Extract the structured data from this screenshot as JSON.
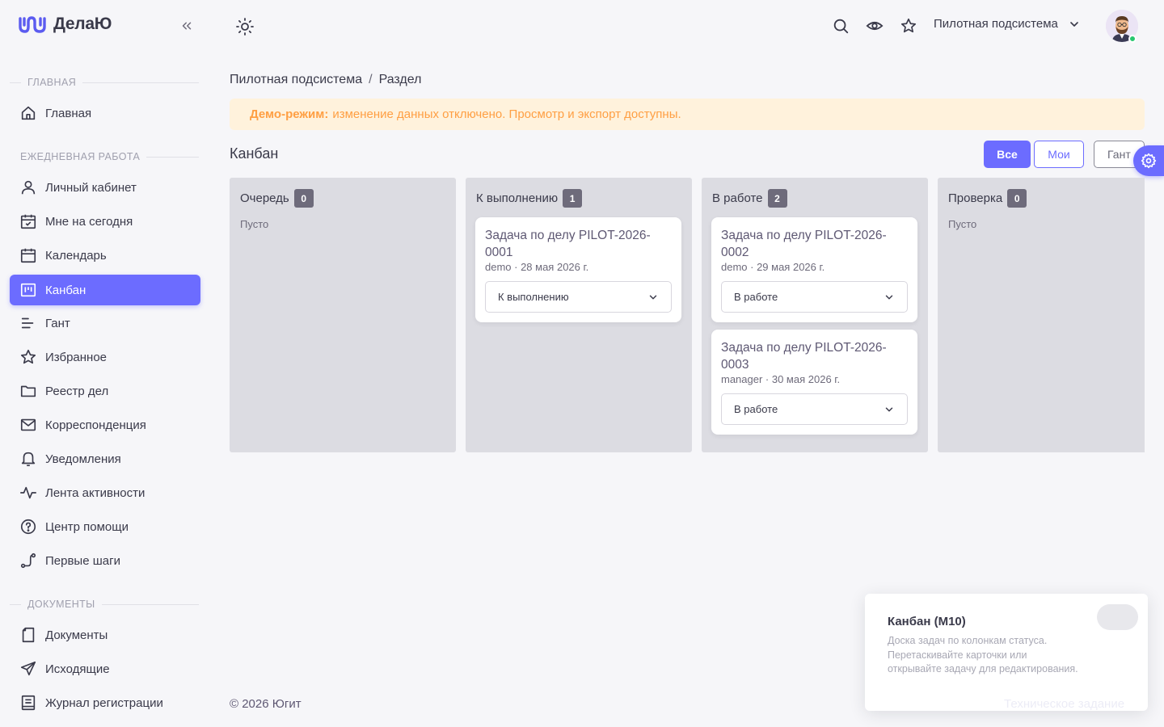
{
  "app": {
    "name": "ДелаЮ"
  },
  "colors": {
    "accent": "#6c6cff",
    "warning": "#ff9f43",
    "warning_bg": "#fff2dc",
    "online": "#28c76f"
  },
  "sidebar": {
    "sections": [
      {
        "title": "ГЛАВНАЯ"
      },
      {
        "title": "ЕЖЕДНЕВНАЯ РАБОТА"
      },
      {
        "title": "ДОКУМЕНТЫ"
      }
    ],
    "items": [
      {
        "label": "Главная",
        "icon": "home-icon"
      },
      {
        "label": "Личный кабинет",
        "icon": "user-icon"
      },
      {
        "label": "Мне на сегодня",
        "icon": "calendar-check-icon"
      },
      {
        "label": "Календарь",
        "icon": "calendar-icon"
      },
      {
        "label": "Канбан",
        "icon": "kanban-icon",
        "active": true
      },
      {
        "label": "Гант",
        "icon": "gantt-icon"
      },
      {
        "label": "Избранное",
        "icon": "star-icon"
      },
      {
        "label": "Реестр дел",
        "icon": "folder-icon"
      },
      {
        "label": "Корреспонденция",
        "icon": "mail-icon"
      },
      {
        "label": "Уведомления",
        "icon": "bell-icon"
      },
      {
        "label": "Лента активности",
        "icon": "activity-icon"
      },
      {
        "label": "Центр помощи",
        "icon": "help-icon"
      },
      {
        "label": "Первые шаги",
        "icon": "route-icon"
      },
      {
        "label": "Документы",
        "icon": "document-icon"
      },
      {
        "label": "Исходящие",
        "icon": "send-icon"
      },
      {
        "label": "Журнал регистрации",
        "icon": "journal-icon"
      }
    ]
  },
  "header": {
    "subsystem": "Пилотная подсистема"
  },
  "breadcrumb": {
    "items": [
      "Пилотная подсистема",
      "Раздел"
    ],
    "separator": "/"
  },
  "alert": {
    "bold": "Демо-режим:",
    "text": "изменение данных отключено. Просмотр и экспорт доступны."
  },
  "page": {
    "title": "Канбан",
    "filters": {
      "all": "Все",
      "mine": "Мои",
      "gantt": "Гант"
    }
  },
  "board": {
    "columns": [
      {
        "title": "Очередь",
        "count": "0",
        "empty": "Пусто",
        "cards": []
      },
      {
        "title": "К выполнению",
        "count": "1",
        "cards": [
          {
            "title": "Задача по делу PILOT-2026-0001",
            "meta": "demo · 28 мая 2026 г.",
            "status": "К выполнению"
          }
        ]
      },
      {
        "title": "В работе",
        "count": "2",
        "cards": [
          {
            "title": "Задача по делу PILOT-2026-0002",
            "meta": "demo · 29 мая 2026 г.",
            "status": "В работе"
          },
          {
            "title": "Задача по делу PILOT-2026-0003",
            "meta": "manager · 30 мая 2026 г.",
            "status": "В работе"
          }
        ]
      },
      {
        "title": "Проверка",
        "count": "0",
        "empty": "Пусто",
        "cards": []
      }
    ]
  },
  "footer": {
    "copyright": "© 2026 Югит"
  },
  "tour": {
    "title": "Канбан (M10)",
    "text": "Доска задач по колонкам статуса. Перетаскивайте карточки или открывайте задачу для редактирования.",
    "link": "Техническое задание"
  }
}
